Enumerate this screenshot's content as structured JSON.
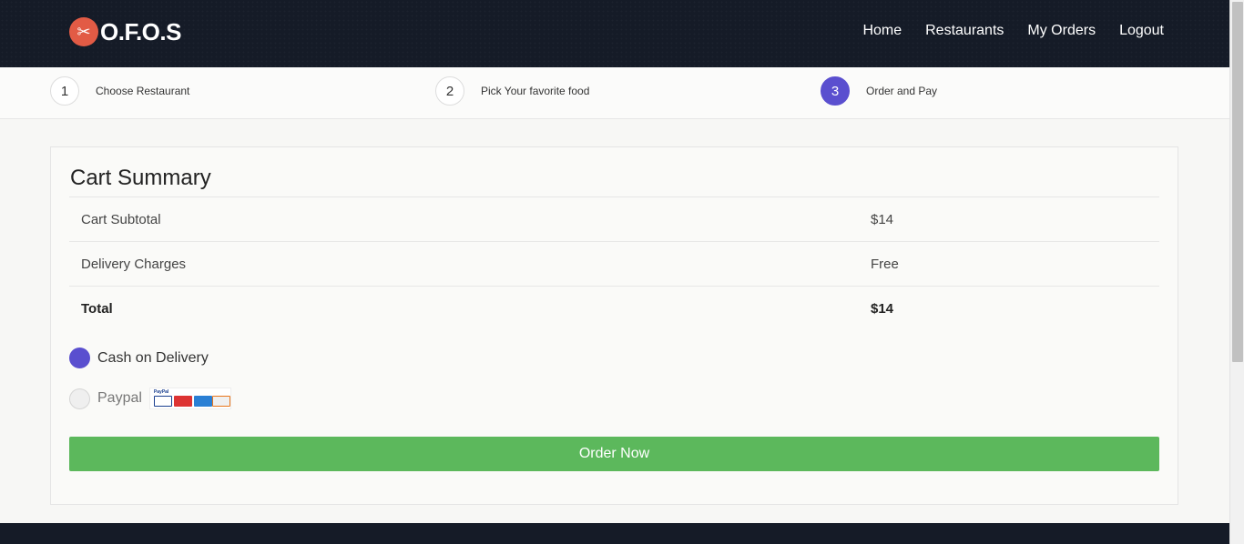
{
  "brand": {
    "name": "O.F.O.S",
    "accent": "#e25b45"
  },
  "nav": {
    "items": [
      "Home",
      "Restaurants",
      "My Orders",
      "Logout"
    ]
  },
  "steps": [
    {
      "num": "1",
      "label": "Choose Restaurant"
    },
    {
      "num": "2",
      "label": "Pick Your favorite food"
    },
    {
      "num": "3",
      "label": "Order and Pay",
      "active": true
    }
  ],
  "cart": {
    "title": "Cart Summary",
    "rows": [
      {
        "label": "Cart Subtotal",
        "value": "$14"
      },
      {
        "label": "Delivery Charges",
        "value": "Free"
      },
      {
        "label": "Total",
        "value": "$14"
      }
    ]
  },
  "payment": {
    "options": [
      {
        "label": "Cash on Delivery",
        "selected": true
      },
      {
        "label": "Paypal",
        "selected": false
      }
    ],
    "paypal_logo_text": "PayPal"
  },
  "order_button": "Order Now",
  "colors": {
    "nav_bg": "#151b27",
    "primary": "#5a4fcf",
    "success": "#5cb85c"
  }
}
